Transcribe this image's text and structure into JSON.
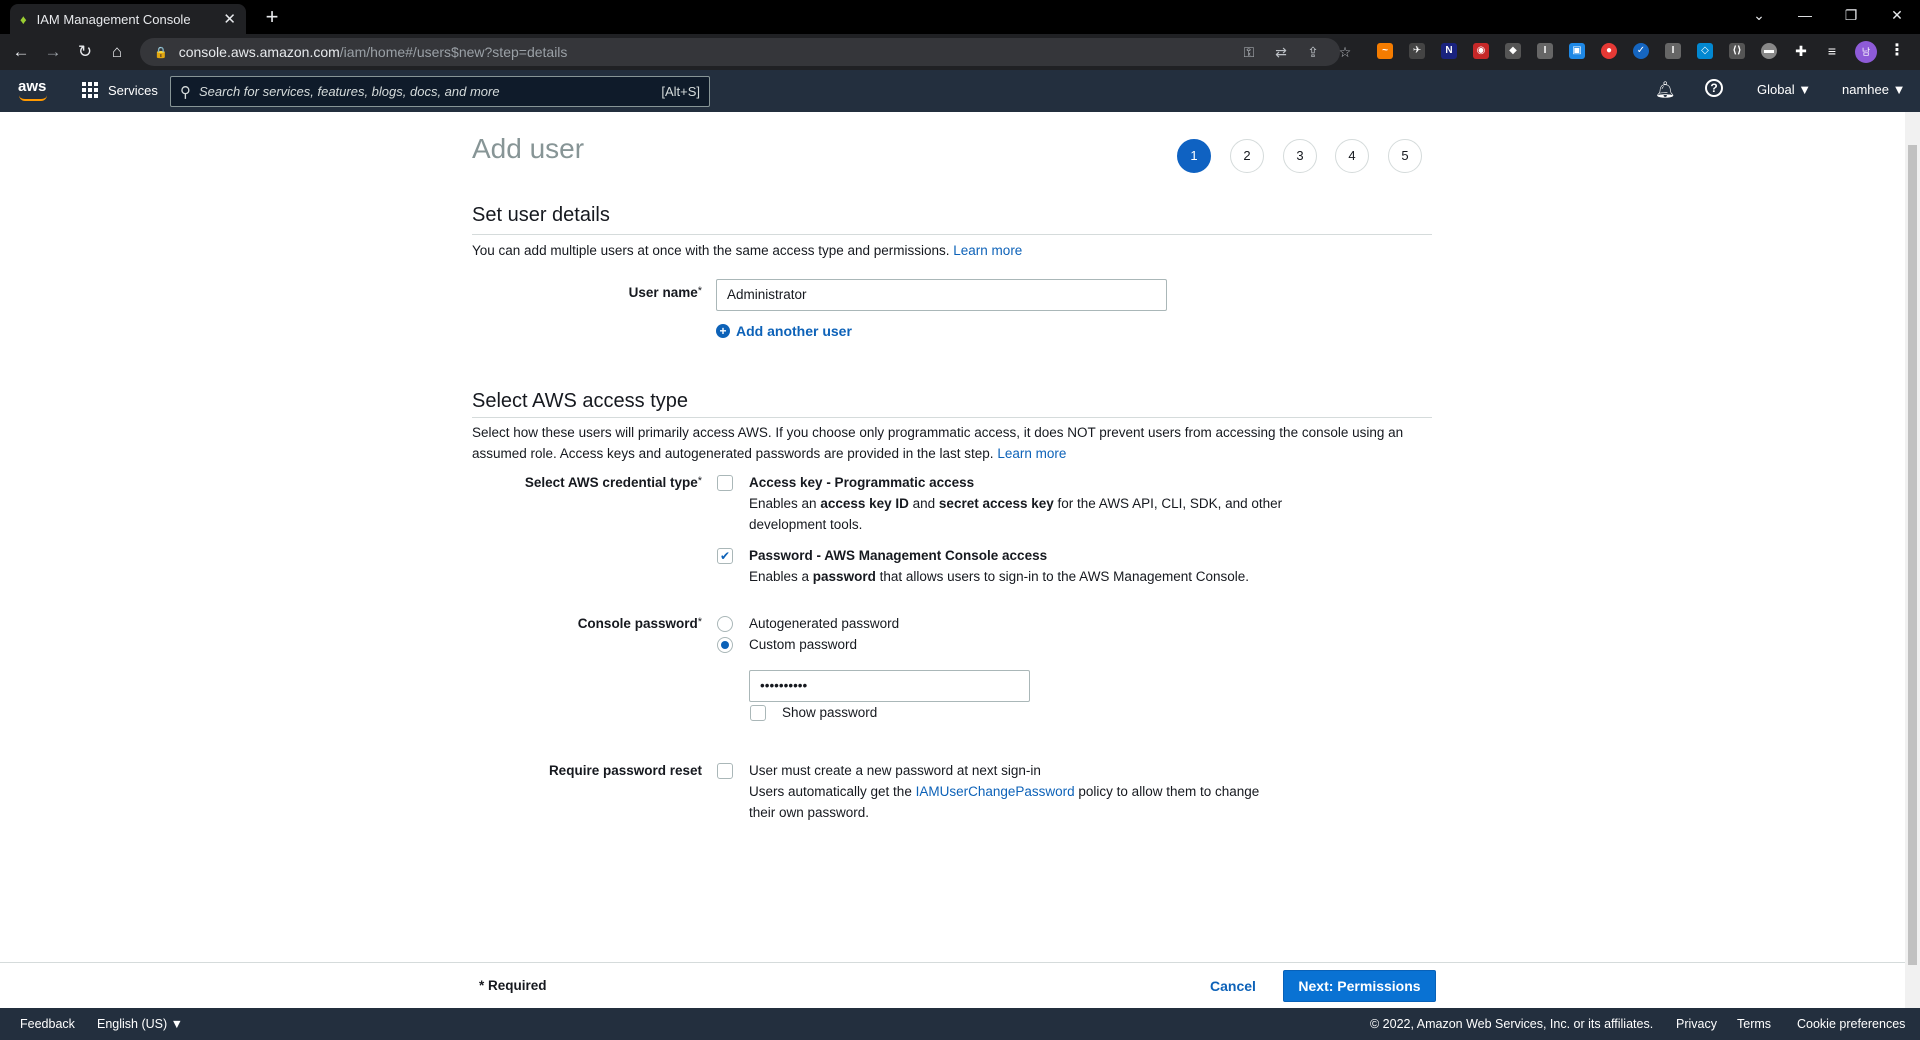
{
  "browser": {
    "tab_title": "IAM Management Console",
    "url_host": "console.aws.amazon.com",
    "url_path": "/iam/home#/users$new?step=details"
  },
  "aws_nav": {
    "logo": "aws",
    "services_label": "Services",
    "search_placeholder": "Search for services, features, blogs, docs, and more",
    "search_shortcut": "[Alt+S]",
    "region": "Global ▼",
    "account": "namhee ▼"
  },
  "page": {
    "title": "Add user",
    "steps": [
      "1",
      "2",
      "3",
      "4",
      "5"
    ],
    "active_step": 1
  },
  "user_details": {
    "section_title": "Set user details",
    "description": "You can add multiple users at once with the same access type and permissions.",
    "learn_more": "Learn more",
    "user_name_label": "User name",
    "user_name_value": "Administrator",
    "add_another_label": "Add another user"
  },
  "access_type": {
    "section_title": "Select AWS access type",
    "description": "Select how these users will primarily access AWS. If you choose only programmatic access, it does NOT prevent users from accessing the console using an assumed role. Access keys and autogenerated passwords are provided in the last step.",
    "learn_more": "Learn more",
    "credential_label": "Select AWS credential type",
    "programmatic": {
      "title": "Access key - Programmatic access",
      "desc_1": "Enables an ",
      "desc_b1": "access key ID",
      "desc_2": " and ",
      "desc_b2": "secret access key",
      "desc_3": " for the AWS API, CLI, SDK, and other development tools.",
      "checked": false
    },
    "console": {
      "title": "Password - AWS Management Console access",
      "desc_1": "Enables a ",
      "desc_b1": "password",
      "desc_2": " that allows users to sign-in to the AWS Management Console.",
      "checked": true
    },
    "console_password_label": "Console password",
    "autogen_label": "Autogenerated password",
    "custom_label": "Custom password",
    "selected_password_type": "custom",
    "password_value": "••••••••••",
    "show_password_label": "Show password",
    "reset_label": "Require password reset",
    "reset_option": "User must create a new password at next sign-in",
    "reset_desc_1": "Users automatically get the ",
    "reset_desc_link": "IAMUserChangePassword",
    "reset_desc_2": " policy to allow them to change their own password."
  },
  "actions": {
    "required": "* Required",
    "cancel": "Cancel",
    "next": "Next: Permissions"
  },
  "footer": {
    "feedback": "Feedback",
    "language": "English (US) ▼",
    "copyright": "© 2022, Amazon Web Services, Inc. or its affiliates.",
    "privacy": "Privacy",
    "terms": "Terms",
    "cookies": "Cookie preferences"
  }
}
